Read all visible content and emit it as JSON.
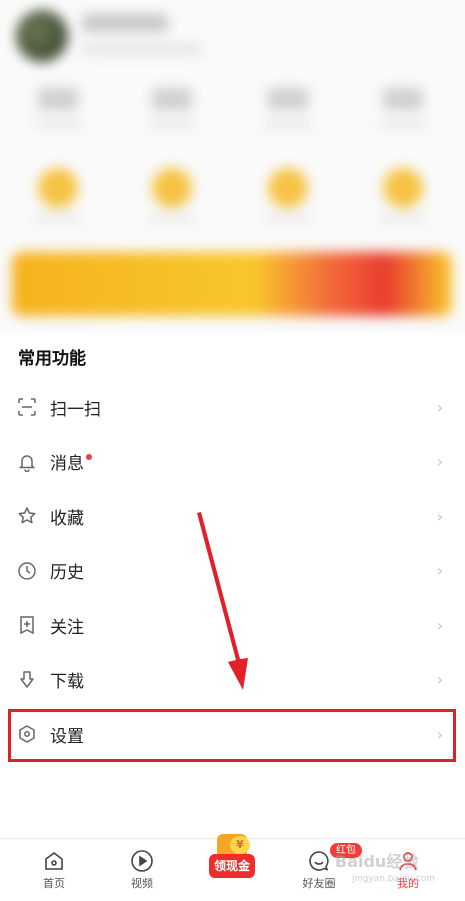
{
  "section": {
    "title": "常用功能"
  },
  "menu": {
    "items": [
      {
        "label": "扫一扫",
        "icon": "scan-icon",
        "has_dot": false
      },
      {
        "label": "消息",
        "icon": "bell-icon",
        "has_dot": true
      },
      {
        "label": "收藏",
        "icon": "star-icon",
        "has_dot": false
      },
      {
        "label": "历史",
        "icon": "clock-icon",
        "has_dot": false
      },
      {
        "label": "关注",
        "icon": "follow-icon",
        "has_dot": false
      },
      {
        "label": "下载",
        "icon": "download-icon",
        "has_dot": false
      },
      {
        "label": "设置",
        "icon": "hexagon-settings-icon",
        "has_dot": false
      }
    ],
    "chevron": "›"
  },
  "bottom_nav": {
    "items": [
      {
        "label": "首页",
        "icon": "home-icon"
      },
      {
        "label": "视频",
        "icon": "play-icon"
      },
      {
        "label": "领现金",
        "icon": "cash-icon"
      },
      {
        "label": "好友圈",
        "icon": "chat-icon",
        "badge": "红包"
      },
      {
        "label": "我的",
        "icon": "person-icon",
        "active": true
      }
    ],
    "coin_symbol": "¥"
  },
  "watermark": {
    "text": "Baidu经验",
    "sub": "jingyan.baidu.com"
  },
  "colors": {
    "accent": "#ee2d2d",
    "highlight": "#e3202a",
    "active_nav": "#f23b3b"
  }
}
